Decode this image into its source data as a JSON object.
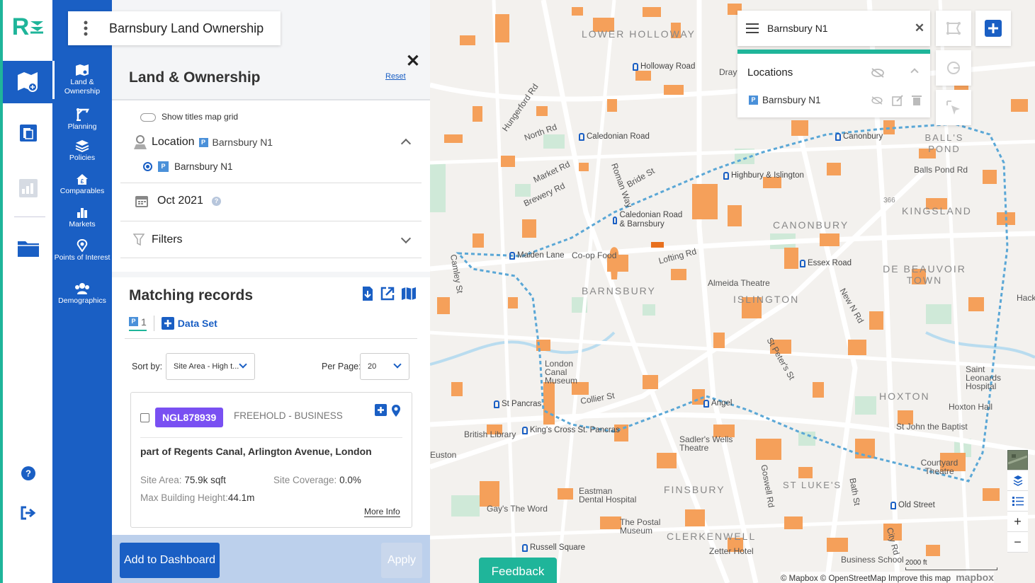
{
  "app": {
    "logo_text": "R",
    "project_title": "Barnsbury Land Ownership"
  },
  "subnav": {
    "items": [
      {
        "label": "Land & Ownership"
      },
      {
        "label": "Planning"
      },
      {
        "label": "Policies"
      },
      {
        "label": "Comparables"
      },
      {
        "label": "Markets"
      },
      {
        "label": "Points of Interest"
      },
      {
        "label": "Demographics"
      }
    ]
  },
  "panel": {
    "header": "Land & Ownership",
    "reset_label": "Reset",
    "show_titles_label": "Show titles map grid",
    "location_label": "Location",
    "location_value": "Barnsbury N1",
    "location_option": "Barnsbury N1",
    "date_value": "Oct 2021",
    "filters_label": "Filters"
  },
  "matching": {
    "title": "Matching records",
    "tab_count": "1",
    "data_set_label": "Data Set",
    "sort_label": "Sort by:",
    "sort_value": "Site Area - High t...",
    "per_page_label": "Per Page:",
    "per_page_value": "20",
    "record": {
      "id": "NGL878939",
      "tenure": "FREEHOLD - BUSINESS",
      "address": "part of Regents Canal, Arlington Avenue, London",
      "site_area_label": "Site Area:",
      "site_area_value": "75.9k sqft",
      "site_coverage_label": "Site Coverage:",
      "site_coverage_value": "0.0%",
      "max_height_label": "Max Building Height:",
      "max_height_value": "44.1m",
      "more_info": "More Info"
    }
  },
  "footer": {
    "add_dashboard": "Add to Dashboard",
    "apply": "Apply"
  },
  "map": {
    "search_value": "Barnsbury N1",
    "locations_header": "Locations",
    "location_item": "Barnsbury N1",
    "feedback": "Feedback",
    "scale_label": "2000 ft",
    "attribution": "© Mapbox © OpenStreetMap Improve this map",
    "mapbox_logo": "mapbox",
    "areas": [
      "LOWER HOLLOWAY",
      "BARNSBURY",
      "ISLINGTON",
      "CANONBURY",
      "KINGSLAND",
      "DE BEAUVOIR TOWN",
      "HOXTON",
      "FINSBURY",
      "CLERKENWELL",
      "ST LUKE'S",
      "BALL'S POND"
    ],
    "stations": [
      "Holloway Road",
      "Caledonian Road",
      "Highbury & Islington",
      "Caledonian Road & Barnsbury",
      "Canonbury",
      "Maiden Lane",
      "Essex Road",
      "St Pancras",
      "King's Cross St. Pancras",
      "Angel",
      "Old Street",
      "Russell Square"
    ],
    "streets": [
      "North Rd",
      "Market Rd",
      "Brewery Rd",
      "Hungerford Rd",
      "Roman Way",
      "Bride St",
      "Balls Pond Rd",
      "New N Rd",
      "St Peter's St",
      "Collier St",
      "Goswell Rd",
      "Bath St",
      "City Rd",
      "Camley St",
      "Co-op Food",
      "Lofting Rd",
      "Almeida Theatre",
      "London Canal Museum",
      "British Library",
      "Sadler's Wells Theatre",
      "Courtyard Theatre",
      "Hoxton Hall",
      "St John the Baptist",
      "Euston",
      "Eastman Dental Hospital",
      "Zetter Hotel",
      "Business School",
      "The Postal Museum",
      "Gay's The Word",
      "Saint Leonards Hospital",
      "Hackney Road",
      "Drayton Park",
      "366"
    ]
  },
  "colors": {
    "brand_green": "#1fb59a",
    "brand_blue": "#1a5fc4",
    "record_badge": "#7950f2",
    "parcel_orange": "#f5a05a",
    "route_blue": "#5aa7d6"
  }
}
